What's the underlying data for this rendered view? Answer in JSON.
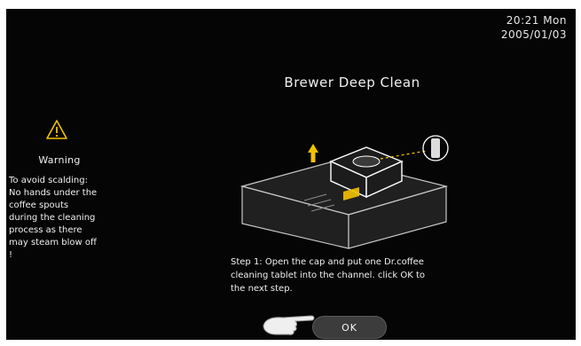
{
  "clock": {
    "time": "20:21 Mon",
    "date": "2005/01/03"
  },
  "screen": {
    "title": "Brewer Deep Clean"
  },
  "warning": {
    "icon": "warning-triangle-icon",
    "title": "Warning",
    "lines": [
      "To avoid scalding:",
      "No hands under the",
      "coffee spouts",
      "during the cleaning",
      "process as there",
      "may steam blow off",
      "!"
    ]
  },
  "step": {
    "lines": [
      "Step 1:  Open the cap and put one Dr.coffee",
      "cleaning tablet into the channel. click OK to",
      "the next step."
    ]
  },
  "ok_button": {
    "label": "OK"
  },
  "colors": {
    "background": "#050505",
    "text": "#f0f0f0",
    "accent": "#f2c200",
    "button": "#3c3c3c"
  }
}
